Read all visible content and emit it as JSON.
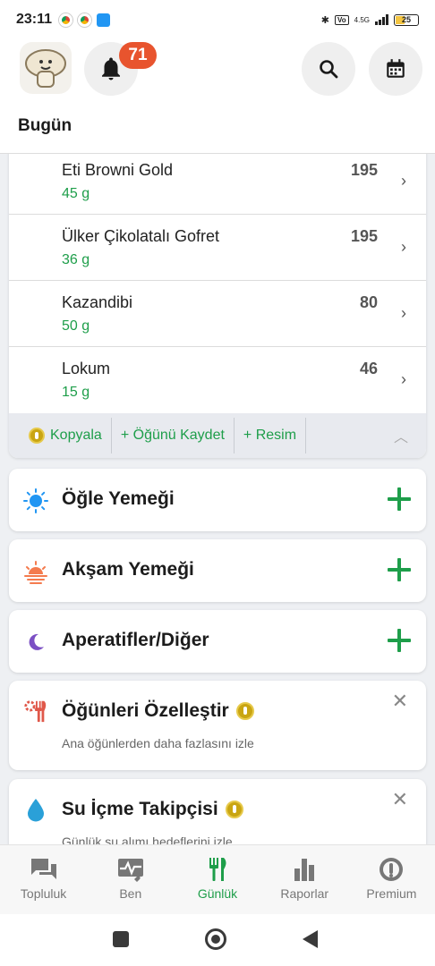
{
  "status_bar": {
    "time": "23:11",
    "battery": "25",
    "network": "4.5G"
  },
  "header": {
    "notification_count": "71",
    "title": "Bugün"
  },
  "foods": [
    {
      "name": "Eti Browni Gold",
      "amount": "45 g",
      "calories": "195"
    },
    {
      "name": "Ülker Çikolatalı Gofret",
      "amount": "36 g",
      "calories": "195"
    },
    {
      "name": "Kazandibi",
      "amount": "50 g",
      "calories": "80"
    },
    {
      "name": "Lokum",
      "amount": "15 g",
      "calories": "46"
    }
  ],
  "actions": {
    "copy": "Kopyala",
    "save_meal": "+ Öğünü Kaydet",
    "photo": "+ Resim"
  },
  "meals": [
    {
      "title": "Öğle Yemeği",
      "icon": "sun-icon"
    },
    {
      "title": "Akşam Yemeği",
      "icon": "sunset-icon"
    },
    {
      "title": "Aperatifler/Diğer",
      "icon": "moon-icon"
    }
  ],
  "promos": [
    {
      "title": "Öğünleri Özelleştir",
      "subtitle": "Ana öğünlerden daha fazlasını izle",
      "icon": "utensils-gear-icon"
    },
    {
      "title": "Su İçme Takipçisi",
      "subtitle": "Günlük su alımı hedeflerini izle",
      "icon": "water-drop-icon"
    }
  ],
  "nav": {
    "items": [
      {
        "label": "Topluluk",
        "icon": "chat-icon"
      },
      {
        "label": "Ben",
        "icon": "heartbeat-icon"
      },
      {
        "label": "Günlük",
        "icon": "utensils-icon"
      },
      {
        "label": "Raporlar",
        "icon": "bar-chart-icon"
      },
      {
        "label": "Premium",
        "icon": "premium-badge-icon"
      }
    ],
    "active": "Günlük"
  },
  "colors": {
    "accent_green": "#1e9e4a",
    "badge_orange": "#e8542e",
    "coin_gold": "#c9a512"
  }
}
